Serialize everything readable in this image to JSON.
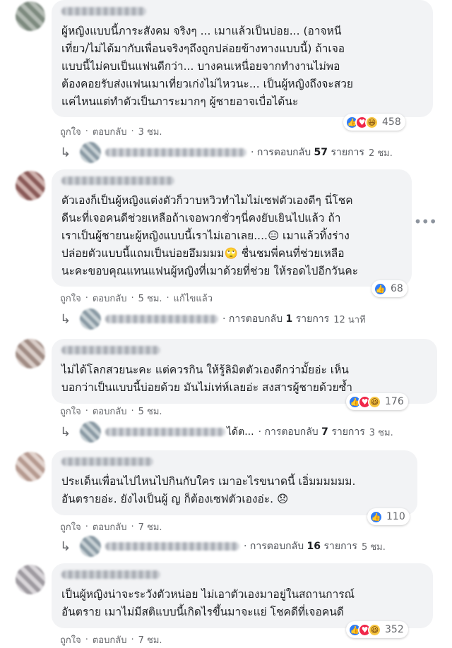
{
  "labels": {
    "like": "ถูกใจ",
    "reply": "ตอบกลับ",
    "dot": "·",
    "replies_prefix": "· การตอบกลับ",
    "replies_suffix": "รายการ"
  },
  "comments": [
    {
      "text": "ผู้หญิงแบบนี้ภาระสังคม จริงๆ ... เมาแล้วเป็นบ่อย... (อาจหนี\nเที่ยว/ไม่ได้มากับเพื่อนจริงๆถึงถูกปล่อยข้างทางแบบนี้) ถ้าเจอ\nแบบนี้ไม่คบเป็นแฟนดีกว่า... บางคนเหนื่อยจากทำงานไม่พอ\nต้องคอยรับส่งแฟนเมาเที่ยวเก่งไม่ไหวนะ... เป็นผู้หญิงถึงจะสวย\nแค่ไหนแต่ทำตัวเป็นภาระมากๆ ผู้ชายอาจเบื่อได้นะ",
      "time": "3 ชม.",
      "reaction_count": "458",
      "reply_partial": "",
      "reply_count": "57",
      "reply_time": "2 ชม."
    },
    {
      "text": "ตัวเองก็เป็นผู้หญิงแต่งตัวก็วาบหวิวทำไมไม่เซฟตัวเองดีๆ นี่โชค\nดีนะที่เจอคนดีช่วยเหลือถ้าเจอพวกชั่วๆนี่คงยับเยินไปแล้ว ถ้า\nเราเป็นผู้ชายนะผู้หญิงแบบนี้เราไม่เอาเลย....😑 เมาแล้วทิ้งร่าง\nปล่อยตัวแบบนี้แถมเป็นบ่อยอึมมมม🙄 ชื่นชมพี่คนที่ช่วยเหลือ\nนะคะขอบคุณแทนแฟนผู้หญิงที่เมาด้วยที่ช่วย ให้รอดไปอีกวันคะ",
      "time": "5 ชม.",
      "edited": "แก้ไขแล้ว",
      "reaction_count": "68",
      "reply_partial": "",
      "reply_count": "1",
      "reply_time": "12 นาที"
    },
    {
      "text": "ไม่ได้โลกสวยนะคะ แต่ควรกิน ให้รู้ลิมิตตัวเองดีกว่ามั้ยอ่ะ เห็น\nบอกว่าเป็นแบบนี้บ่อยด้วย มันไม่เท่ห์เลยอ่ะ สงสารผู้ชายด้วยซ้ำ",
      "time": "5 ชม.",
      "reaction_count": "176",
      "reply_partial": "ได้ต...",
      "reply_count": "7",
      "reply_time": "3 ชม."
    },
    {
      "text": "ประเด็นเพื่อนไปไหนไปกินกับใคร เมาอะไรขนาดนี้ เอิ่มมมมมม.\nอันตรายอ่ะ. ยังไงเป็นผู้ ญ ก็ต้องเซฟตัวเองอ่ะ. 😞",
      "time": "7 ชม.",
      "reaction_count": "110",
      "reply_partial": "",
      "reply_count": "16",
      "reply_time": "5 ชม."
    },
    {
      "text": "เป็นผู้หญิงน่าจะระวังตัวหน่อย ไม่เอาตัวเองมาอยู่ในสถานการณ์\nอันตราย เมาไม่มีสติแบบนี้เกิดไรขึ้นมาจะแย่ โชคดีที่เจอคนดี",
      "time": "7 ชม.",
      "reaction_count": "352"
    }
  ]
}
